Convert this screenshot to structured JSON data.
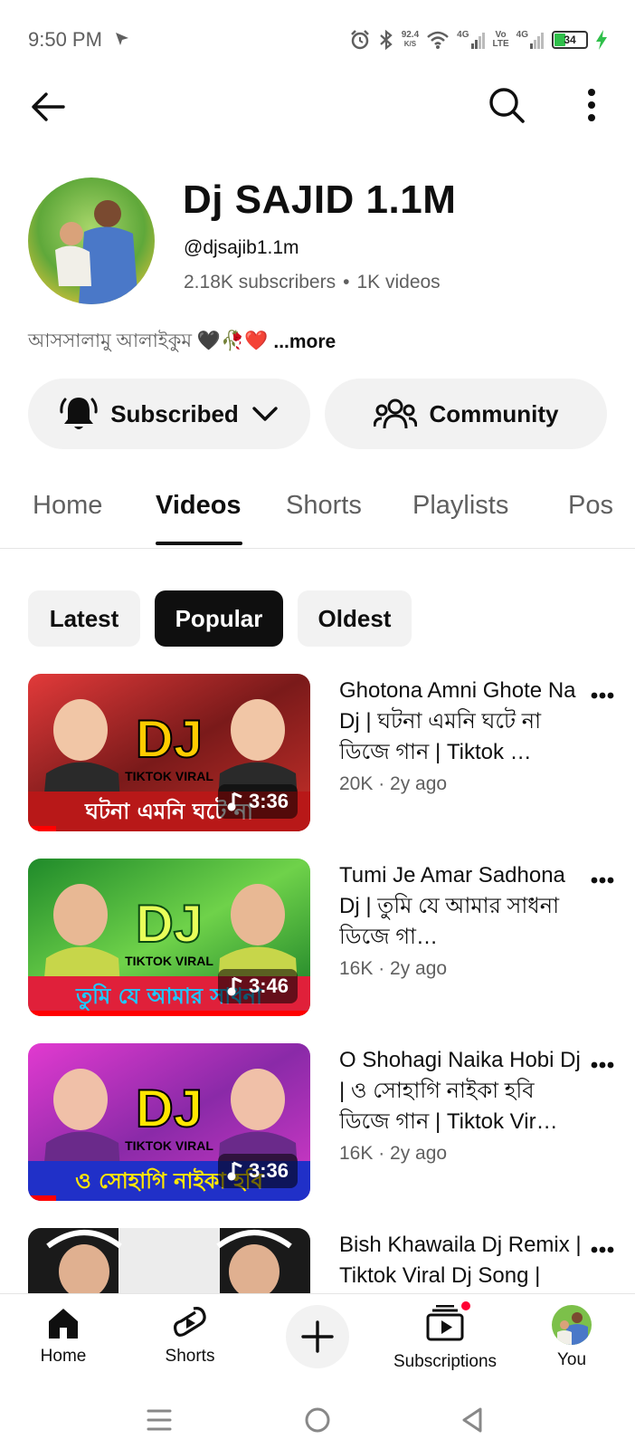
{
  "status_bar": {
    "time": "9:50 PM",
    "net_speed_value": "92.4",
    "net_speed_unit": "K/S",
    "network_1": "4G",
    "volte_1": "Vo",
    "volte_2": "LTE",
    "network_2": "4G",
    "battery_level": "34",
    "battery_color": "#2fbf4a"
  },
  "top_bar": {
    "back_icon": "arrow-left-icon",
    "search_icon": "search-icon",
    "more_icon": "more-vert-icon"
  },
  "channel": {
    "name": "Dj SAJID 1.1M",
    "handle": "@djsajib1.1m",
    "subscribers": "2.18K subscribers",
    "separator": "•",
    "videos": "1K videos",
    "description": "আসসালামু আলাইকুম 🖤🥀❤️",
    "more_label": "...more"
  },
  "actions": {
    "subscribe_label": "Subscribed",
    "community_label": "Community"
  },
  "tabs": [
    {
      "label": "Home"
    },
    {
      "label": "Videos"
    },
    {
      "label": "Shorts"
    },
    {
      "label": "Playlists"
    },
    {
      "label": "Pos"
    }
  ],
  "active_tab": "Videos",
  "chips": [
    {
      "label": "Latest"
    },
    {
      "label": "Popular"
    },
    {
      "label": "Oldest"
    }
  ],
  "active_chip": "Popular",
  "videos": [
    {
      "title": "Ghotona Amni Ghote Na Dj | ঘটনা এমনি ঘটে না ডিজে গান | Tiktok …",
      "meta": "20K · 2y ago",
      "duration": "3:36",
      "thumb_text_top": "DJ",
      "thumb_text_mid": "TIKTOK VIRAL",
      "thumb_text_bottom": "ঘটনা এমনি ঘটে না",
      "progress": 0.1
    },
    {
      "title": "Tumi Je Amar Sadhona Dj | তুমি যে আমার সাধনা ডিজে গা…",
      "meta": "16K · 2y ago",
      "duration": "3:46",
      "thumb_text_top": "DJ",
      "thumb_text_mid": "TIKTOK VIRAL",
      "thumb_text_bottom": "তুমি যে আমার সাধনা",
      "progress": 1.0
    },
    {
      "title": "O Shohagi Naika Hobi Dj | ও সোহাগি নাইকা হবি ডিজে গান | Tiktok Vir…",
      "meta": "16K · 2y ago",
      "duration": "3:36",
      "thumb_text_top": "DJ",
      "thumb_text_mid": "TIKTOK VIRAL",
      "thumb_text_bottom": "ও সোহাগি নাইকা হবি",
      "progress": 0.1
    },
    {
      "title": "Bish Khawaila Dj Remix | Tiktok Viral Dj Song | Bangla Dj Song",
      "meta": "",
      "duration": "",
      "thumb_text_top": "",
      "thumb_text_mid": "",
      "thumb_text_bottom": "",
      "progress": 0
    }
  ],
  "bottom_nav": {
    "home_label": "Home",
    "shorts_label": "Shorts",
    "subscriptions_label": "Subscriptions",
    "you_label": "You"
  },
  "colors": {
    "accent_red": "#ff0000",
    "chip_active_bg": "#0f0f0f",
    "pill_bg": "#f2f2f2"
  }
}
